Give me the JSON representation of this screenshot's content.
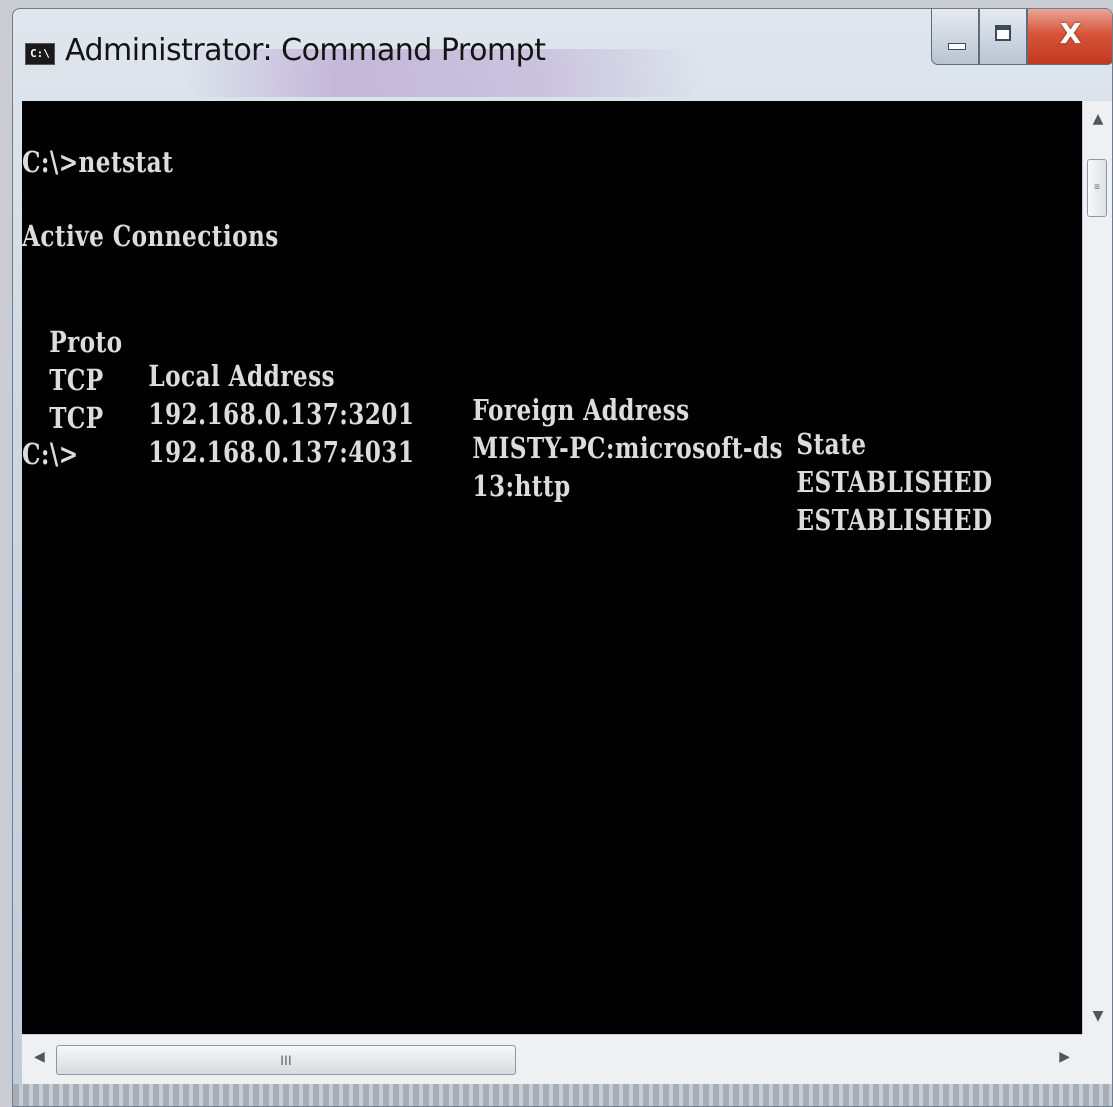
{
  "window": {
    "title": "Administrator: Command Prompt",
    "icon_text": "C:\\",
    "buttons": {
      "minimize_icon": "minimize-icon",
      "maximize_icon": "maximize-icon",
      "close_label": "X"
    }
  },
  "console": {
    "command_line": "C:\\>netstat",
    "section_heading": "Active Connections",
    "headers": {
      "proto": "Proto",
      "local": "Local Address",
      "foreign": "Foreign Address",
      "state": "State"
    },
    "rows": [
      {
        "proto": "TCP",
        "local": "192.168.0.137:3201",
        "foreign": "MISTY-PC:microsoft-ds",
        "state": "ESTABLISHED"
      },
      {
        "proto": "TCP",
        "local": "192.168.0.137:4031",
        "foreign": "13:http",
        "state": "ESTABLISHED"
      }
    ],
    "prompt": "C:\\>"
  },
  "scrollbars": {
    "vertical_up_icon": "arrow-up-icon",
    "vertical_down_icon": "arrow-down-icon",
    "vertical_grip": "≡",
    "horizontal_left_icon": "arrow-left-icon",
    "horizontal_right_icon": "arrow-right-icon",
    "horizontal_grip": "III"
  },
  "colors": {
    "console_background": "#000000",
    "console_text": "#dcdcdc",
    "close_button": "#c9452a"
  }
}
